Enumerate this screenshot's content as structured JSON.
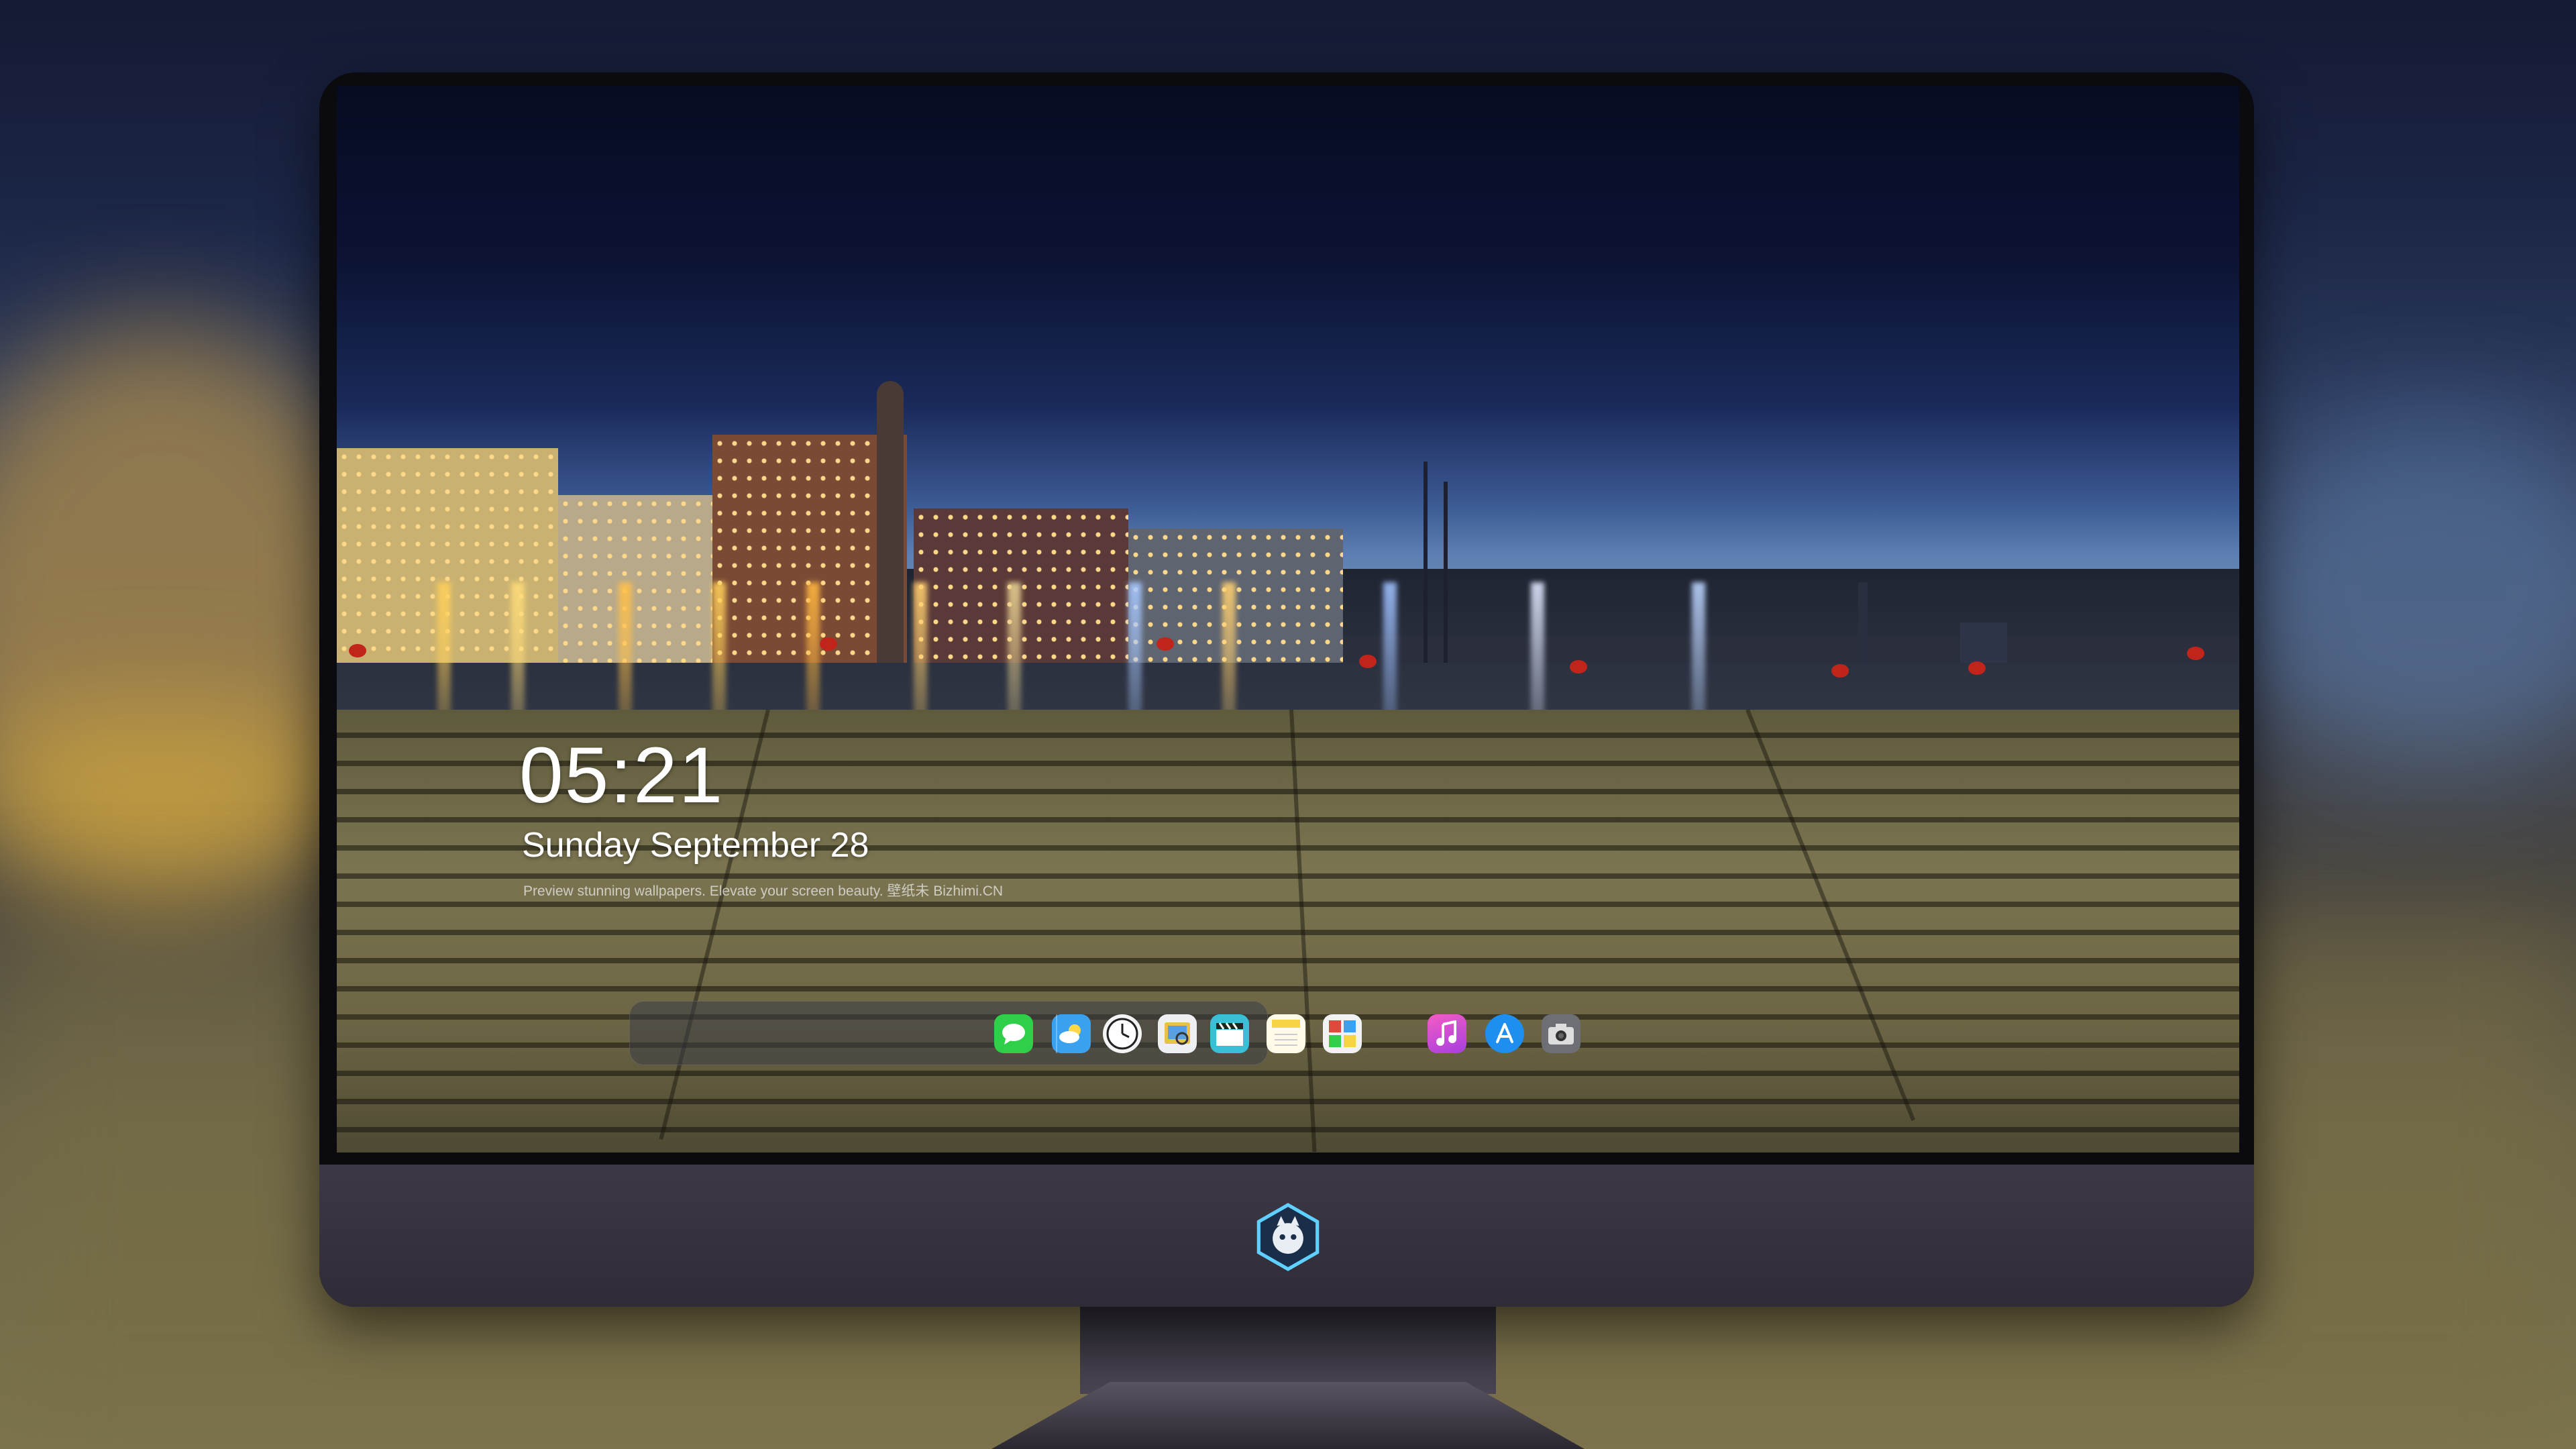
{
  "lockscreen": {
    "time": "05:21",
    "date": "Sunday September  28",
    "tagline": "Preview stunning wallpapers. Elevate your screen beauty. 壁纸未 Bizhimi.CN"
  },
  "dock": {
    "apps": [
      {
        "name": "Messages",
        "icon": "message-bubble-icon",
        "color": "#2fcf4a"
      },
      {
        "name": "Weather",
        "icon": "weather-icon",
        "color": "#3aa0f0"
      },
      {
        "name": "Clock",
        "icon": "clock-icon",
        "color": "#f4f4f4"
      },
      {
        "name": "Preview",
        "icon": "preview-icon",
        "color": "#e7c24a"
      },
      {
        "name": "Clips",
        "icon": "clapperboard-icon",
        "color": "#39c0d6"
      },
      {
        "name": "Notes",
        "icon": "notes-icon",
        "color": "#f6d443"
      },
      {
        "name": "Photo Booth",
        "icon": "photo-booth-icon",
        "color": "#e04a3c"
      },
      {
        "name": "Music",
        "icon": "music-note-icon",
        "color": "#c547d8"
      },
      {
        "name": "App Store",
        "icon": "app-store-icon",
        "color": "#1e8ef0"
      },
      {
        "name": "Camera",
        "icon": "camera-icon",
        "color": "#7a7a80"
      }
    ]
  },
  "colors": {
    "monitor_chin": "#35323d",
    "screen_bezel": "#0b0b0f"
  }
}
